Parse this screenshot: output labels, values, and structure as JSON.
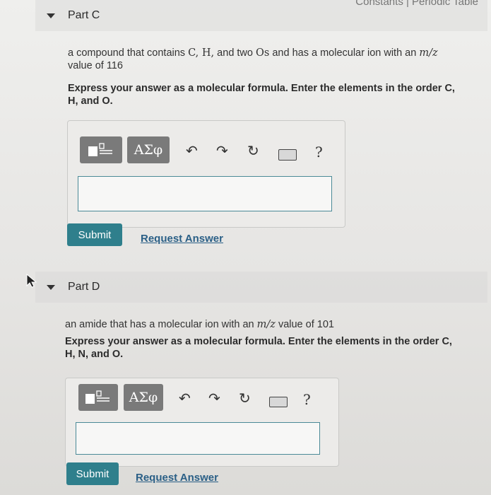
{
  "top_link": "Constants | Periodic Table",
  "partC": {
    "title": "Part C",
    "question_pre": "a compound that contains ",
    "question_elems": "C, H,",
    "question_mid": " and two ",
    "question_os": "Os",
    "question_post": " and has a molecular ion with an ",
    "question_mz": "m/z",
    "question_value": "value of 116",
    "instruction_1": "Express your answer as a molecular formula. Enter the elements in the order C,",
    "instruction_2": "H, and O.",
    "toolbar_greek": "ΑΣφ",
    "help": "?",
    "input_value": "",
    "submit_label": "Submit",
    "request_label": "Request Answer"
  },
  "partD": {
    "title": "Part D",
    "question_pre": "an amide that has a molecular ion with an ",
    "question_mz": "m/z",
    "question_post": " value of 101",
    "instruction_1": "Express your answer as a molecular formula. Enter the elements in the order C,",
    "instruction_2": "H, N, and O.",
    "toolbar_greek": "ΑΣφ",
    "help": "?",
    "input_value": "",
    "submit_label": "Submit",
    "request_label": "Request Answer"
  }
}
